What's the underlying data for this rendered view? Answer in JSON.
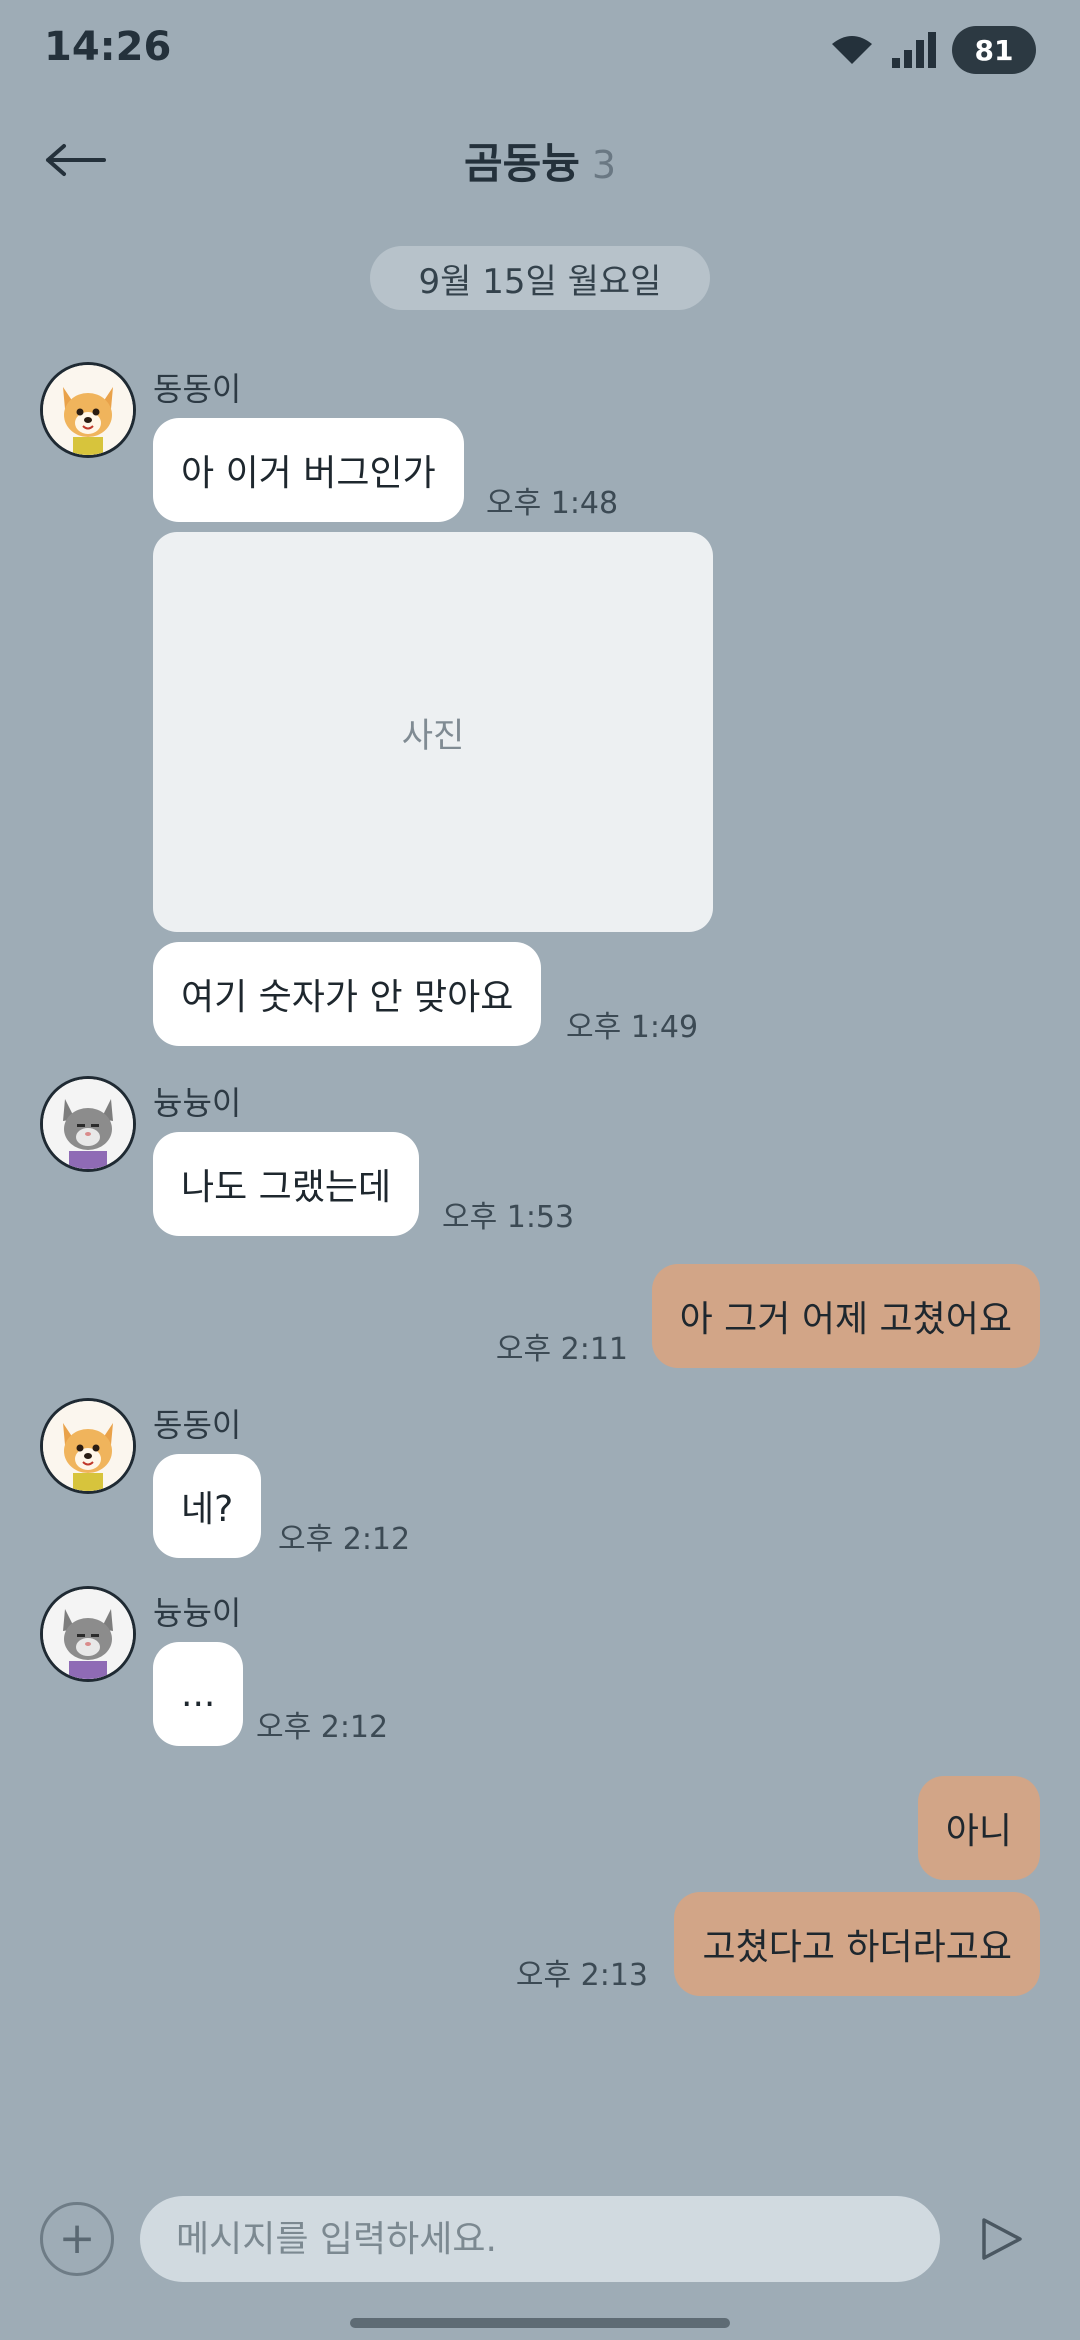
{
  "status": {
    "time": "14:26",
    "battery": "81"
  },
  "header": {
    "title": "곰동늉",
    "member_count": "3"
  },
  "date_divider": "9월 15일 월요일",
  "photo_placeholder": "사진",
  "messages": [
    {
      "sender": "동동이",
      "avatar": "dog-avatar",
      "text": "아 이거 버그인가",
      "time": "오후 1:48"
    },
    {
      "sender": "동동이",
      "text": "여기 숫자가 안 맞아요",
      "time": "오후 1:49"
    },
    {
      "sender": "늉늉이",
      "avatar": "cat-avatar",
      "text": "나도 그랬는데",
      "time": "오후 1:53"
    },
    {
      "sender": "me",
      "text": "아 그거 어제 고쳤어요",
      "time": "오후 2:11"
    },
    {
      "sender": "동동이",
      "avatar": "dog-avatar",
      "text": "네?",
      "time": "오후 2:12"
    },
    {
      "sender": "늉늉이",
      "avatar": "cat-avatar",
      "text": "...",
      "time": "오후 2:12"
    },
    {
      "sender": "me",
      "text": "아니",
      "time": ""
    },
    {
      "sender": "me",
      "text": "고쳤다고 하더라고요",
      "time": "오후 2:13"
    }
  ],
  "input": {
    "placeholder": "메시지를 입력하세요.",
    "value": ""
  },
  "colors": {
    "background": "#9eacb6",
    "my_bubble": "#d2a587",
    "other_bubble": "#ffffff"
  }
}
